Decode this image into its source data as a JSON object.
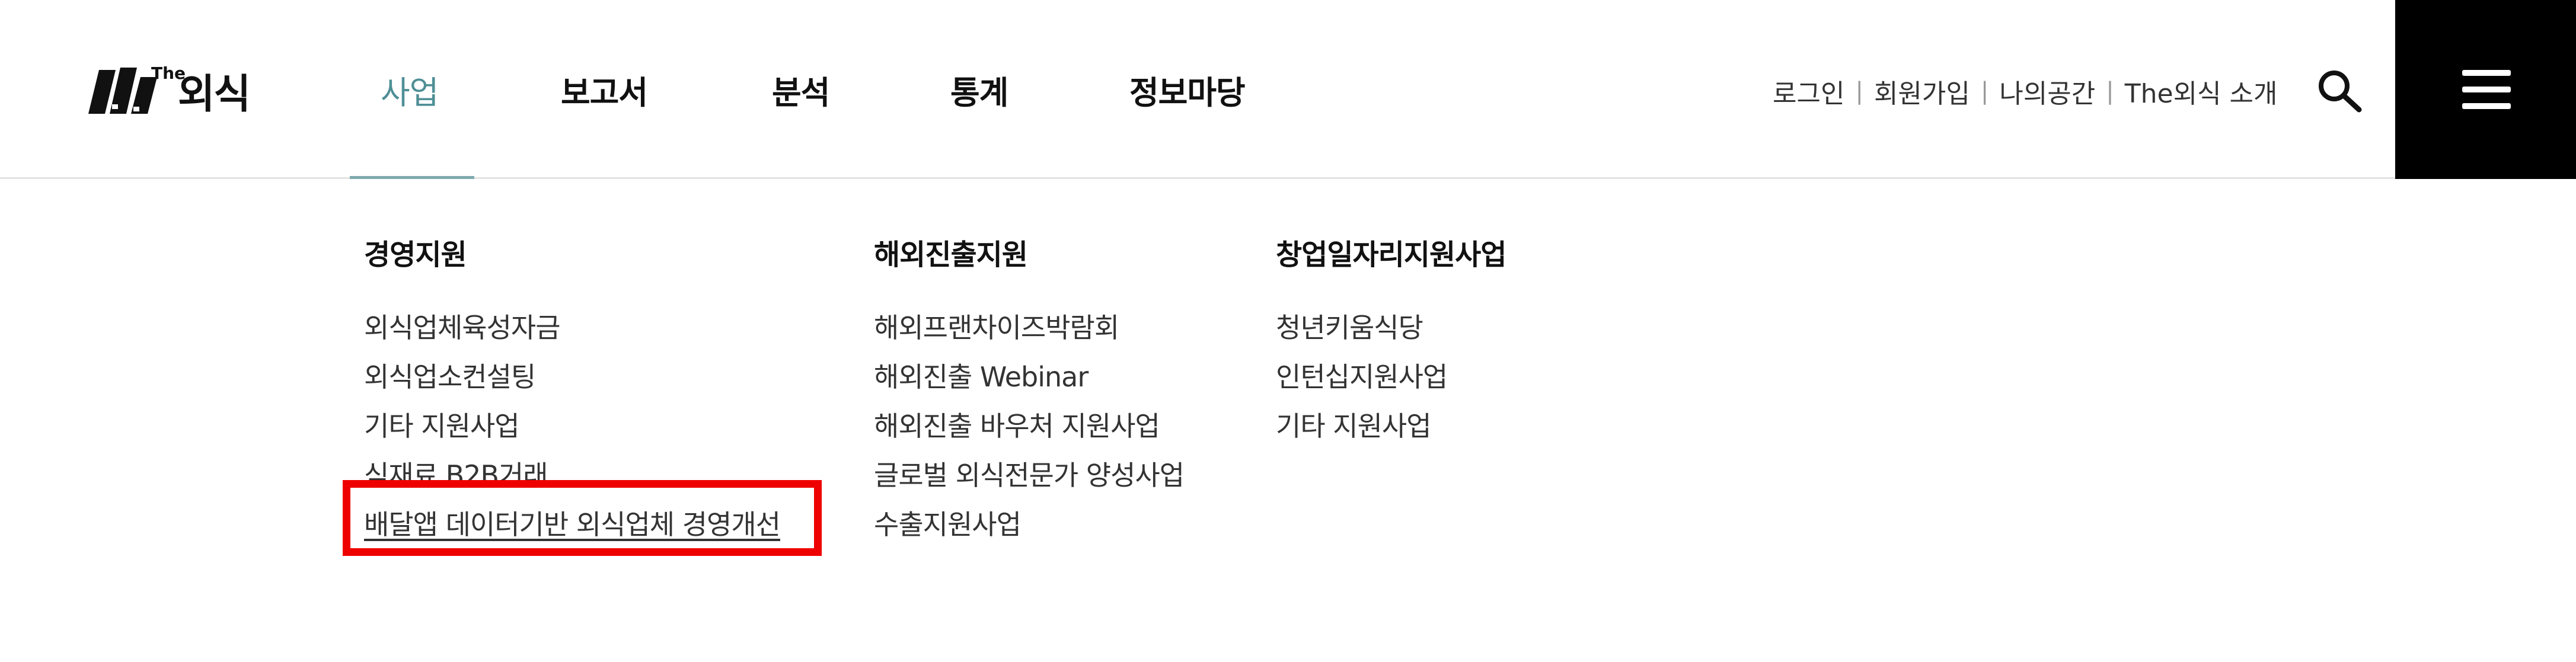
{
  "logo": {
    "the": "The",
    "name": "외식",
    "icon": "book-stack-logo"
  },
  "gnb": [
    "사업",
    "보고서",
    "분석",
    "통계",
    "정보마당"
  ],
  "util": [
    "로그인",
    "회원가입",
    "나의공간",
    "The외식 소개"
  ],
  "icons": {
    "search": "search-icon",
    "menu": "hamburger-menu-icon"
  },
  "colors": {
    "active": "#4f8f96",
    "highlight": "#ee0000",
    "menu_bg": "#000000"
  },
  "submenu": {
    "col1": {
      "title": "경영지원",
      "items": [
        "외식업체육성자금",
        "외식업소컨설팅",
        "기타 지원사업",
        "식재료 B2B거래",
        "배달앱 데이터기반 외식업체 경영개선"
      ]
    },
    "col2": {
      "title": "해외진출지원",
      "items": [
        "해외프랜차이즈박람회",
        "해외진출 Webinar",
        "해외진출 바우처 지원사업",
        "글로벌 외식전문가 양성사업",
        "수출지원사업"
      ]
    },
    "col3": {
      "title": "창업일자리지원사업",
      "items": [
        "청년키움식당",
        "인턴십지원사업",
        "기타 지원사업"
      ]
    }
  }
}
